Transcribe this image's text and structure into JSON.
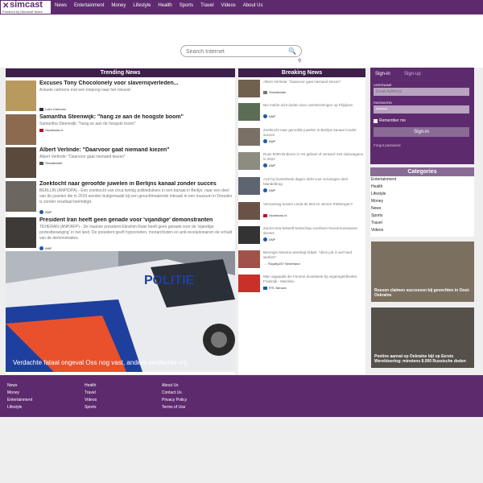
{
  "brand": {
    "name": "simcast",
    "powered": "Powered by Microsoft News"
  },
  "nav": [
    "News",
    "Entertainment",
    "Money",
    "Lifestyle",
    "Health",
    "Sports",
    "Travel",
    "Videos",
    "About Us"
  ],
  "search": {
    "placeholder": "Search Internet",
    "submit_icon": "search-icon",
    "hint_icon": "magnifier-icon"
  },
  "trending": {
    "title": "Trending News",
    "items": [
      {
        "headline": "Excuses Tony Chocolonely voor slavernijverleden...",
        "desc": "Actuele cartoons met een knipoog naar het nieuws!",
        "source": "Loko Cartoons"
      },
      {
        "headline": "Samantha Steenwijk: \"hang ze aan de hoogste boom\"",
        "desc": "Samantha Steenwijk: \"hang ze aan de hoogste boom\"",
        "source": "Vipnieuws.nl"
      },
      {
        "headline": "Albert Verlinde: \"Daarvoor gaat niemand kiezen\"",
        "desc": "Albert Verlinde: \"Daarvoor gaat niemand kiezen\"",
        "source": "Showbizsite"
      },
      {
        "headline": "Zoektocht naar geroofde juwelen in Berlijns kanaal zonder succes",
        "desc": "BERLIJN (ANP/DPA) - Een zoektocht van circa twintig politieduikers in een kanaal in Berlijn, naar een deel van de juwelen die in 2019 werden buitgemaakt bij een geruchtmakende inbraak in een museum in Dresden is zonder resultaat beëindigd.",
        "source": "ANP"
      },
      {
        "headline": "President Iran heeft geen genade voor 'vijandige' demonstranten",
        "desc": "TEHERAN (ANP/AFP) - De Iraanse president Ebrahim Raisi heeft geen genade voor de 'vijandige protestbeweging' in het land. De president geeft hypocrieten, monarchisten en anti-revolutionairen de schuld van de demonstraties.",
        "source": "ANP"
      }
    ],
    "feature_caption": "Verdachte fataal ongeval Oss nog vast, andere verdachte vrij",
    "feature_text": "POLITIE"
  },
  "breaking": {
    "title": "Breaking News",
    "items": [
      {
        "text": "Albert Verlinde: \"Daarvoor gaat niemand kiezen\"",
        "source": "Showbizsite"
      },
      {
        "text": "Nie melde acht doden door overstromingen op Filipijnen",
        "source": "ANP"
      },
      {
        "text": "Zoektocht naar geroofde juwelen in Berlijns kanaal zonder succes",
        "source": "ANP"
      },
      {
        "text": "Ruim 6000 kinderen in VS geboet of verward met sluiswagens in 2022",
        "source": "ANP"
      },
      {
        "text": "A12 bij Oosterbeek dagen dicht voor vervangen deel Mandelbrug",
        "source": "ANP"
      },
      {
        "text": "Verzoening tussen Linda de Mol en Jeroen Rietbergen?",
        "source": "Vipnieuws.nl"
      },
      {
        "text": "Zuid-Korea bekeeft botsschap voorheen Noord-Koreaanse drones",
        "source": "ANP"
      },
      {
        "text": "Berengin Maxima weerlegt briljek: \"deze job is wel hard werken\"",
        "source": "Royalty207 Nederland"
      },
      {
        "text": "Man opgepakt die Femme doodsteek bij ongeregeldheden Frankrijk - Marokko",
        "source": "RTL Nieuws"
      }
    ]
  },
  "login": {
    "tab_signin": "Sign-in",
    "tab_signup": "Sign-up",
    "username_label": "USERNAME",
    "username_placeholder": "Email Address",
    "password_label": "PASSWORD",
    "password_value": "••••••••",
    "remember": "Remember me",
    "button": "Sign-in",
    "forgot": "Forgot password"
  },
  "categories": {
    "title": "Categories",
    "items": [
      "Entertainment",
      "Health",
      "Lifestyle",
      "Money",
      "News",
      "Sports",
      "Travel",
      "Videos"
    ]
  },
  "side_features": [
    {
      "caption": "Russen claimen successen bij gevechten in Oost-Oekraïne"
    },
    {
      "caption": "Poetins aanval op Oekraïne bijt op Eerste Wereldoorlog: minstens 8.000 Russische doden"
    }
  ],
  "footer": {
    "col1": [
      "News",
      "Money",
      "Entertainment",
      "Lifestyle"
    ],
    "col2": [
      "Health",
      "Travel",
      "Videos",
      "Sports"
    ],
    "col3": [
      "About Us",
      "Contact Us",
      "Privacy Policy",
      "Terms of Use"
    ]
  },
  "colors": {
    "brand": "#5e2a6e",
    "dark": "#3d1f4a",
    "anp": "#1e5aa8"
  }
}
